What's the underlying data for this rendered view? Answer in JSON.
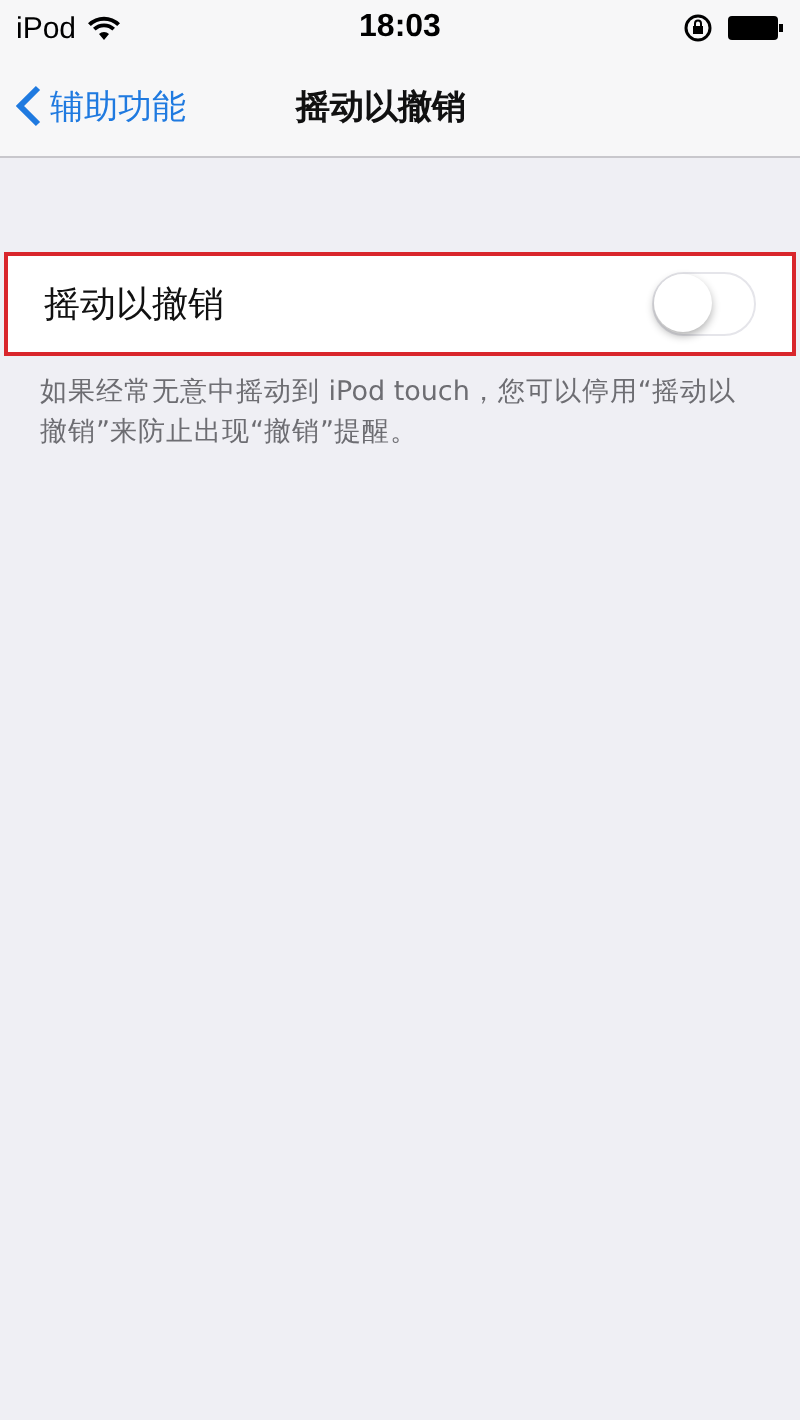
{
  "status_bar": {
    "carrier": "iPod",
    "time": "18:03"
  },
  "nav_bar": {
    "back_label": "辅助功能",
    "title": "摇动以撤销"
  },
  "setting": {
    "label": "摇动以撤销",
    "on": false,
    "highlighted": true
  },
  "footer": "如果经常无意中摇动到 iPod touch，您可以停用“摇动以撤销”来防止出现“撤销”提醒。"
}
